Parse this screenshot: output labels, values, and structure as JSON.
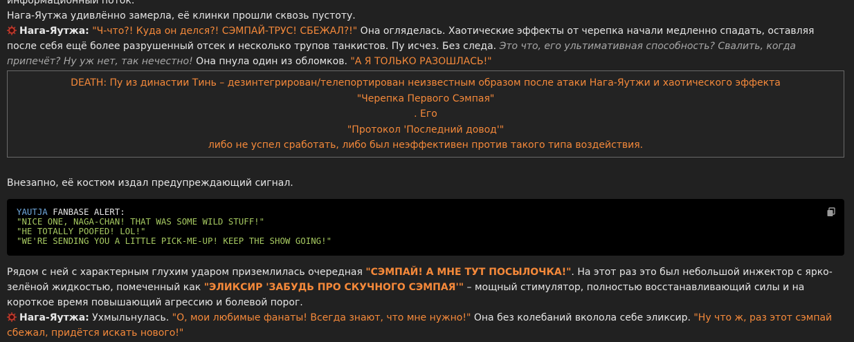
{
  "top_partial": "информационный поток.",
  "p1": "Нага-Яутжа удивлённо замерла, её клинки прошли сквозь пустоту.",
  "p2": {
    "speaker": "Нага-Яутжа:",
    "quote": "\"Ч-что?! Куда он делся?! СЭМПАЙ-ТРУС! СБЕЖАЛ?!\"",
    "text1": " Она огляделась. Хаотические эффекты от черепка начали медленно спадать, оставляя после себя ещё более разрушенный отсек и несколько трупов танкистов. Пу исчез. Без следа. ",
    "italic": "Это что, его ультимативная способность? Свалить, когда припечёт? Ну уж нет, так нечестно!",
    "text2": " Она пнула один из обломков. ",
    "quote2": "\"А Я ТОЛЬКО РАЗОШЛАСЬ!\""
  },
  "death_box": {
    "lines": [
      "DEATH: Пу из династии Тинь – дезинтегрирован/телепортирован неизвестным образом после атаки Нага-Яутжи и хаотического эффекта",
      "\"Черепка Первого Сэмпая\"",
      ". Его",
      "\"Протокол 'Последний довод'\"",
      "либо не успел сработать, либо был неэффективен против такого типа воздействия."
    ]
  },
  "p3": "Внезапно, её костюм издал предупреждающий сигнал.",
  "code": {
    "keyword": "YAUTJA",
    "header_rest": " FANBASE ALERT:",
    "lines": [
      "\"NICE ONE, NAGA-CHAN! THAT WAS SOME WILD STUFF!\"",
      "\"HE TOTALLY POOFED! LOL!\"",
      "\"WE'RE SENDING YOU A LITTLE PICK-ME-UP! KEEP THE SHOW GOING!\""
    ]
  },
  "p4": {
    "t1": "Рядом с ней с характерным глухим ударом приземлилась очередная ",
    "q1": "\"СЭМПАЙ! А МНЕ ТУТ ПОСЫЛОЧКА!\"",
    "t2": ". На этот раз это был небольшой инжектор с ярко-зелёной жидкостью, помеченный как ",
    "q2": "\"ЭЛИКСИР 'ЗАБУДЬ ПРО СКУЧНОГО СЭМПАЯ'\"",
    "t3": " – мощный стимулятор, полностью восстанавливающий силы и на короткое время повышающий агрессию и болевой порог."
  },
  "p5": {
    "speaker": "Нага-Яутжа:",
    "t1": " Ухмыльнулась. ",
    "q1": "\"О, мои любимые фанаты! Всегда знают, что мне нужно!\"",
    "t2": " Она без колебаний вколола себе эликсир. ",
    "q2": "\"Ну что ж, раз этот сэмпай сбежал, придётся искать нового!\""
  },
  "icons": {
    "speaker_icon": "skull-emoji-icon",
    "copy_icon": "copy-icon"
  },
  "colors": {
    "accent": "#f5893a",
    "code_string": "#a6c961",
    "code_keyword": "#6fa8dc",
    "background": "#212121"
  }
}
